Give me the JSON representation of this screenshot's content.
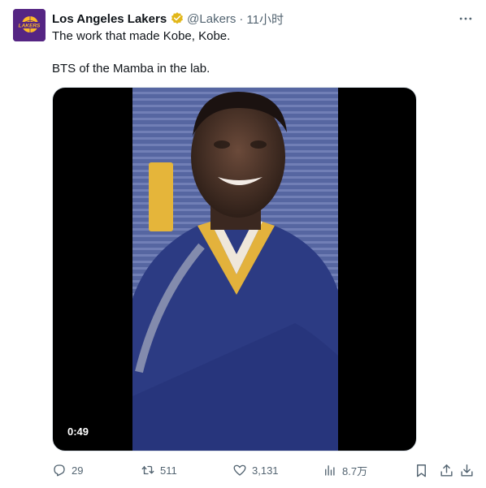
{
  "tweet": {
    "author": {
      "display_name": "Los Angeles Lakers",
      "handle": "@Lakers",
      "separator": "·",
      "time": "11小时",
      "avatar_text": "LAKERS",
      "verified_icon": "verified-badge-icon"
    },
    "text_lines": [
      "The work that made Kobe, Kobe.",
      "BTS of the Mamba in the lab."
    ],
    "media": {
      "type": "video",
      "duration": "0:49"
    },
    "actions": {
      "replies": "29",
      "retweets": "511",
      "likes": "3,131",
      "views": "8.7万"
    }
  },
  "colors": {
    "text_primary": "#0f1419",
    "text_secondary": "#536471",
    "lakers_purple": "#552583",
    "lakers_gold": "#fdb927",
    "verified_gold": "#e2b719"
  }
}
